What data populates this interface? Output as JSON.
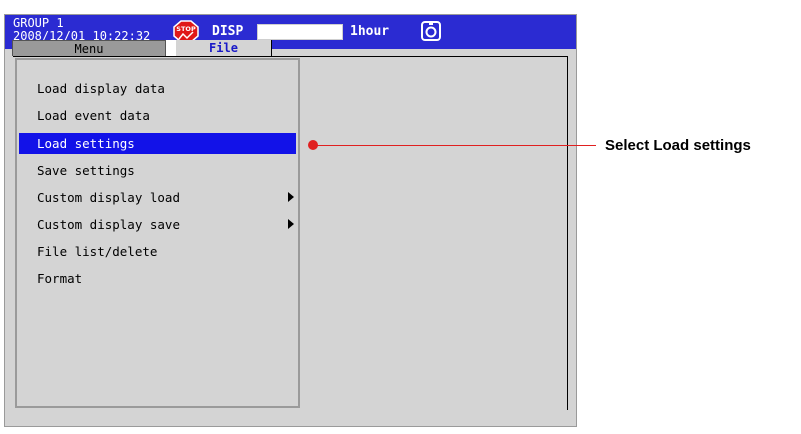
{
  "statusbar": {
    "group": "GROUP 1",
    "datetime": "2008/12/01 10:22:32",
    "stop_icon": "stop-sign-icon",
    "mode": "DISP",
    "interval": "1hour",
    "snapshot_icon": "snapshot-icon",
    "progress": 0
  },
  "tabs": [
    {
      "label": "Menu",
      "active": false
    },
    {
      "label": "File",
      "active": true
    }
  ],
  "menu": {
    "items": [
      {
        "label": "Load display data",
        "submenu": false,
        "selected": false
      },
      {
        "label": "Load event data",
        "submenu": false,
        "selected": false
      },
      {
        "label": "Load settings",
        "submenu": false,
        "selected": true
      },
      {
        "label": "Save settings",
        "submenu": false,
        "selected": false
      },
      {
        "label": "Custom display load",
        "submenu": true,
        "selected": false
      },
      {
        "label": "Custom display save",
        "submenu": true,
        "selected": false
      },
      {
        "label": "File list/delete",
        "submenu": false,
        "selected": false
      },
      {
        "label": "Format",
        "submenu": false,
        "selected": false
      }
    ]
  },
  "callout": {
    "text": "Select Load settings",
    "color": "#e02020"
  },
  "colors": {
    "statusbar_bg": "#2b2bd2",
    "selection": "#1212e8",
    "panel_bg": "#d4d4d4"
  }
}
